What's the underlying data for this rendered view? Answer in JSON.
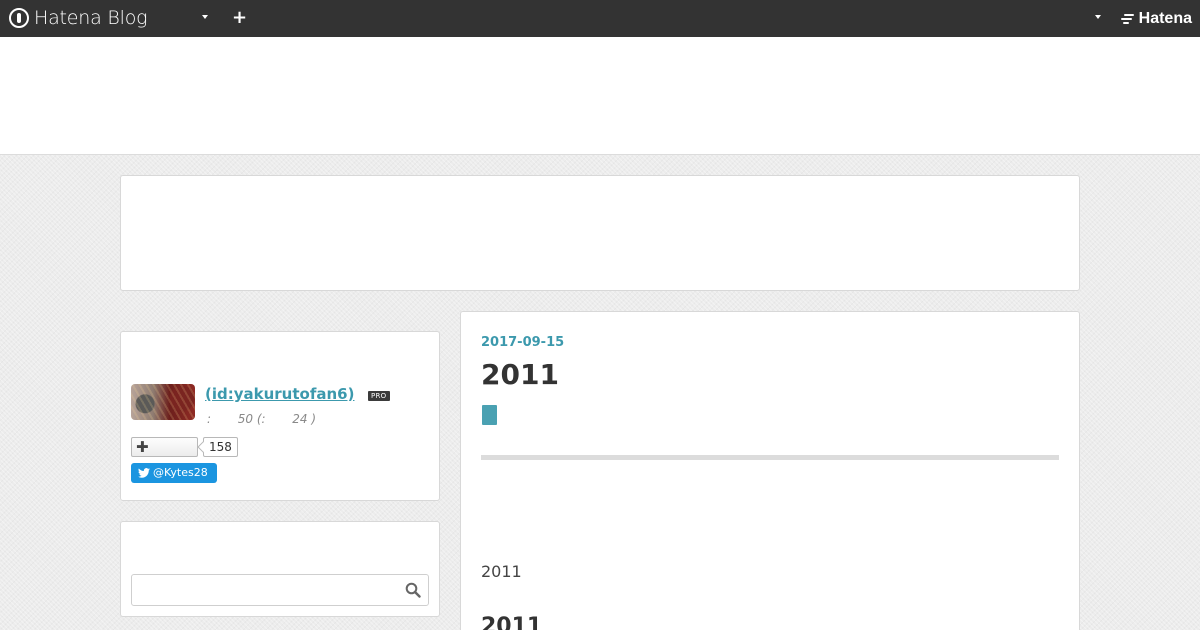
{
  "header": {
    "brand": "Hatena Blog",
    "hatena_logo": "Hatena",
    "add_icon": "plus-icon",
    "dropdown_icon": "caret-down-icon"
  },
  "profile": {
    "name": " (id:yakurutofan6)",
    "badge": "PRO",
    "stats": ":       50 (:       24 )",
    "follow_icon": "plus-icon",
    "follow_count": "158",
    "twitter_handle": "@Kytes28"
  },
  "search": {
    "value": "",
    "placeholder": "",
    "icon": "search-icon"
  },
  "entry": {
    "date": "2017-09-15",
    "title": "2011",
    "body_text": "2011",
    "heading": "2011"
  },
  "colors": {
    "header_bg": "#333333",
    "accent": "#3c99ad",
    "twitter": "#1b95e0"
  }
}
